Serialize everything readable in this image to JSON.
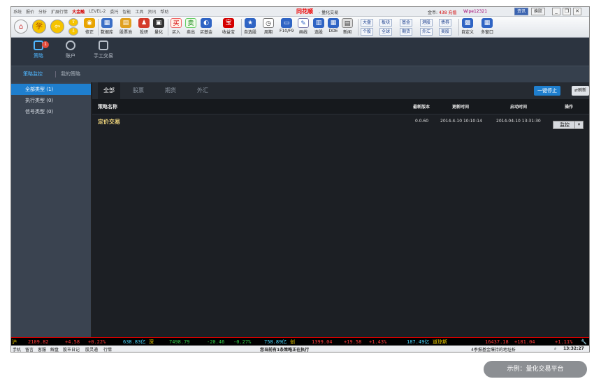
{
  "menu": [
    "系统",
    "报价",
    "分析",
    "扩展行情",
    "大金融",
    "LEVEL-2",
    "委托",
    "智能",
    "工具",
    "资讯",
    "帮助"
  ],
  "brand": "同花顺",
  "window_title": "- 量化交易",
  "coins_label": "金币:",
  "coins_value": "438",
  "recharge": "充值",
  "username": "Wipe12321",
  "top_buttons": {
    "news": "资讯",
    "skin": "换肤"
  },
  "toolbar": {
    "fix": "修正",
    "datalib": "数据库",
    "stockpool": "股票池",
    "quanttool": "投研",
    "quant": "量化",
    "buy": "买入",
    "sell": "卖出",
    "buyfund": "买基金",
    "yieldbao": "收益宝",
    "watch": "自选股",
    "cycle": "周期",
    "f10": "F10/F9",
    "draw": "画线",
    "pick": "选股",
    "dde": "DDE",
    "news": "新闻",
    "market_grid": [
      "大盘",
      "板块",
      "基金",
      "港股",
      "债券",
      "个股",
      "全球",
      "期货",
      "外汇",
      "美股"
    ],
    "custom": "自定义",
    "multiwin": "多窗口"
  },
  "nav": {
    "strategy": "策略",
    "account": "账户",
    "manual": "手工交易",
    "badge": "1"
  },
  "subnav": {
    "monitor": "策略监控",
    "mine": "我的策略"
  },
  "side": [
    "全部类型 (1)",
    "执行类型 (0)",
    "信号类型 (0)"
  ],
  "tabs": [
    "全部",
    "股票",
    "期货",
    "外汇"
  ],
  "actions": {
    "stop_all": "一键停止",
    "refresh": "刷新"
  },
  "columns": {
    "name": "策略名称",
    "version": "最新版本",
    "updated": "更新时间",
    "started": "启动时间",
    "op": "操作"
  },
  "rows": [
    {
      "name": "定价交易",
      "version": "0.0.60",
      "updated": "2014-4-10 10:10:14",
      "started": "2014-04-10 13:31:30",
      "op": "监控"
    }
  ],
  "ticker": {
    "sh_label": "沪",
    "sh_value": "2109.82",
    "sh_change": "+4.58",
    "sh_pct": "+0.22%",
    "sh_amt": "638.83亿",
    "sz_label": "深",
    "sz_value": "7498.79",
    "sz_change": "-20.46",
    "sz_pct": "-0.27%",
    "sz_amt": "758.89亿",
    "cy_label": "创",
    "cy_value": "1399.04",
    "cy_change": "+19.58",
    "cy_pct": "+1.43%",
    "cy_amt": "187.49亿",
    "dj_label": "道琼斯",
    "dj_value": "16437.18",
    "dj_change": "+181.04",
    "dj_pct": "+1.11%"
  },
  "status": {
    "items": [
      "手机",
      "留言",
      "客服",
      "解盘",
      "股市日记",
      "股灵通",
      "行情"
    ],
    "center": "您当前有1条策略正在执行",
    "news": "4季报基金爆持的地址析",
    "time": "13:32:27"
  },
  "caption": "示例：量化交易平台",
  "colors": {
    "accent": "#1f7fce",
    "up": "#ff3b3b",
    "down": "#35d04a",
    "amount": "#f0d000",
    "name_gold": "#f4d97e"
  }
}
